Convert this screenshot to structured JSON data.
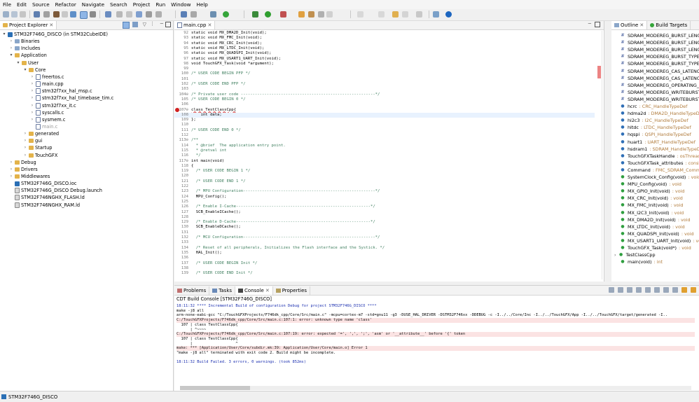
{
  "menu": [
    "File",
    "Edit",
    "Source",
    "Refactor",
    "Navigate",
    "Search",
    "Project",
    "Run",
    "Window",
    "Help"
  ],
  "project_explorer": {
    "tab_label": "Project Explorer",
    "tree": [
      {
        "label": "STM32F746G_DISCO (in STM32CubeIDE)",
        "depth": 0,
        "arrow": "▾",
        "kind": "ioc",
        "bold": true
      },
      {
        "label": "Binaries",
        "depth": 1,
        "arrow": "›",
        "kind": "pkg"
      },
      {
        "label": "Includes",
        "depth": 1,
        "arrow": "›",
        "kind": "pkg"
      },
      {
        "label": "Application",
        "depth": 1,
        "arrow": "▾",
        "kind": "folder"
      },
      {
        "label": "User",
        "depth": 2,
        "arrow": "▾",
        "kind": "folder"
      },
      {
        "label": "Core",
        "depth": 3,
        "arrow": "▾",
        "kind": "folder"
      },
      {
        "label": "freertos.c",
        "depth": 4,
        "arrow": "›",
        "kind": "cfile"
      },
      {
        "label": "main.cpp",
        "depth": 4,
        "arrow": "›",
        "kind": "cfile"
      },
      {
        "label": "stm32f7xx_hal_msp.c",
        "depth": 4,
        "arrow": "›",
        "kind": "cfile"
      },
      {
        "label": "stm32f7xx_hal_timebase_tim.c",
        "depth": 4,
        "arrow": "›",
        "kind": "cfile"
      },
      {
        "label": "stm32f7xx_it.c",
        "depth": 4,
        "arrow": "›",
        "kind": "cfile"
      },
      {
        "label": "syscalls.c",
        "depth": 4,
        "arrow": "›",
        "kind": "cfile"
      },
      {
        "label": "sysmem.c",
        "depth": 4,
        "arrow": "›",
        "kind": "cfile"
      },
      {
        "label": "main.c",
        "depth": 4,
        "arrow": "",
        "kind": "cfile",
        "dim": true
      },
      {
        "label": "generated",
        "depth": 3,
        "arrow": "›",
        "kind": "folder"
      },
      {
        "label": "gui",
        "depth": 3,
        "arrow": "›",
        "kind": "folder"
      },
      {
        "label": "Startup",
        "depth": 3,
        "arrow": "›",
        "kind": "folder"
      },
      {
        "label": "TouchGFX",
        "depth": 3,
        "arrow": "›",
        "kind": "folder"
      },
      {
        "label": "Debug",
        "depth": 1,
        "arrow": "›",
        "kind": "folder"
      },
      {
        "label": "Drivers",
        "depth": 1,
        "arrow": "›",
        "kind": "folder"
      },
      {
        "label": "Middlewares",
        "depth": 1,
        "arrow": "›",
        "kind": "folder"
      },
      {
        "label": "STM32F746G_DISCO.ioc",
        "depth": 1,
        "arrow": "",
        "kind": "ioc"
      },
      {
        "label": "STM32F746G_DISCO Debug.launch",
        "depth": 1,
        "arrow": "",
        "kind": "ld"
      },
      {
        "label": "STM32F746NGHX_FLASH.ld",
        "depth": 1,
        "arrow": "",
        "kind": "ld"
      },
      {
        "label": "STM32F746NGHX_RAM.ld",
        "depth": 1,
        "arrow": "",
        "kind": "ld"
      }
    ]
  },
  "editor": {
    "tab_label": "main.cpp",
    "lines": [
      {
        "n": "92",
        "t": "static void MX_DMA2D_Init(void);"
      },
      {
        "n": "93",
        "t": "static void MX_FMC_Init(void);"
      },
      {
        "n": "94",
        "t": "static void MX_CRC_Init(void);"
      },
      {
        "n": "95",
        "t": "static void MX_LTDC_Init(void);"
      },
      {
        "n": "96",
        "t": "static void MX_QUADSPI_Init(void);"
      },
      {
        "n": "97",
        "t": "static void MX_USART1_UART_Init(void);"
      },
      {
        "n": "98",
        "t": "void TouchGFX_Task(void *argument);"
      },
      {
        "n": "99",
        "t": ""
      },
      {
        "n": "100",
        "t": "/* USER CODE BEGIN PFP */",
        "c": true
      },
      {
        "n": "101",
        "t": ""
      },
      {
        "n": "102",
        "t": "/* USER CODE END PFP */",
        "c": true
      },
      {
        "n": "103",
        "t": ""
      },
      {
        "n": "104⊖",
        "t": "/* Private user code ---------------------------------------------------------*/",
        "c": true
      },
      {
        "n": "105",
        "t": "/* USER CODE BEGIN 0 */",
        "c": true
      },
      {
        "n": "106",
        "t": ""
      },
      {
        "n": "107⊖",
        "t": "class TestClassCpp{",
        "err": true
      },
      {
        "n": "108",
        "t": "    int data;",
        "hl": true
      },
      {
        "n": "109",
        "t": "};"
      },
      {
        "n": "110",
        "t": ""
      },
      {
        "n": "111",
        "t": "/* USER CODE END 0 */",
        "c": true
      },
      {
        "n": "112",
        "t": ""
      },
      {
        "n": "113⊖",
        "t": "/**",
        "c": true
      },
      {
        "n": "114",
        "t": "  * @brief  The application entry point.",
        "c": true
      },
      {
        "n": "115",
        "t": "  * @retval int",
        "c": true
      },
      {
        "n": "116",
        "t": "  */",
        "c": true
      },
      {
        "n": "117⊖",
        "t": "int main(void)"
      },
      {
        "n": "118",
        "t": "{"
      },
      {
        "n": "119",
        "t": "  /* USER CODE BEGIN 1 */",
        "c": true
      },
      {
        "n": "120",
        "t": ""
      },
      {
        "n": "121",
        "t": "  /* USER CODE END 1 */",
        "c": true
      },
      {
        "n": "122",
        "t": ""
      },
      {
        "n": "123",
        "t": "  /* MPU Configuration--------------------------------------------------------*/",
        "c": true
      },
      {
        "n": "124",
        "t": "  MPU_Config();"
      },
      {
        "n": "125",
        "t": ""
      },
      {
        "n": "126",
        "t": "  /* Enable I-Cache---------------------------------------------------------*/",
        "c": true
      },
      {
        "n": "127",
        "t": "  SCB_EnableICache();"
      },
      {
        "n": "128",
        "t": ""
      },
      {
        "n": "129",
        "t": "  /* Enable D-Cache---------------------------------------------------------*/",
        "c": true
      },
      {
        "n": "130",
        "t": "  SCB_EnableDCache();"
      },
      {
        "n": "131",
        "t": ""
      },
      {
        "n": "132",
        "t": "  /* MCU Configuration--------------------------------------------------------*/",
        "c": true
      },
      {
        "n": "133",
        "t": ""
      },
      {
        "n": "134",
        "t": "  /* Reset of all peripherals, Initializes the Flash interface and the Systick. */",
        "c": true
      },
      {
        "n": "135",
        "t": "  HAL_Init();"
      },
      {
        "n": "136",
        "t": ""
      },
      {
        "n": "137",
        "t": "  /* USER CODE BEGIN Init */",
        "c": true
      },
      {
        "n": "138",
        "t": ""
      },
      {
        "n": "139",
        "t": "  /* USER CODE END Init */",
        "c": true
      }
    ]
  },
  "outline": {
    "tabs": [
      "Outline",
      "Build Targets"
    ],
    "items": [
      {
        "name": "SDRAM_MODEREG_BURST_LENGTH",
        "type": "",
        "icon": "hash"
      },
      {
        "name": "SDRAM_MODEREG_BURST_LENGTH",
        "type": "",
        "icon": "hash"
      },
      {
        "name": "SDRAM_MODEREG_BURST_LENGTH",
        "type": "",
        "icon": "hash"
      },
      {
        "name": "SDRAM_MODEREG_BURST_TYPE_",
        "type": "",
        "icon": "hash"
      },
      {
        "name": "SDRAM_MODEREG_BURST_TYPE_",
        "type": "",
        "icon": "hash"
      },
      {
        "name": "SDRAM_MODEREG_CAS_LATENCY",
        "type": "",
        "icon": "hash"
      },
      {
        "name": "SDRAM_MODEREG_CAS_LATENCY",
        "type": "",
        "icon": "hash"
      },
      {
        "name": "SDRAM_MODEREG_OPERATING_M",
        "type": "",
        "icon": "hash"
      },
      {
        "name": "SDRAM_MODEREG_WRITEBURST",
        "type": "",
        "icon": "hash"
      },
      {
        "name": "SDRAM_MODEREG_WRITEBURST",
        "type": "",
        "icon": "hash"
      },
      {
        "name": "hcrc",
        "type": " : CRC_HandleTypeDef",
        "icon": "var"
      },
      {
        "name": "hdma2d",
        "type": " : DMA2D_HandleTypeDef",
        "icon": "var"
      },
      {
        "name": "hi2c3",
        "type": " : I2C_HandleTypeDef",
        "icon": "var"
      },
      {
        "name": "hltdc",
        "type": " : LTDC_HandleTypeDef",
        "icon": "var"
      },
      {
        "name": "hqspi",
        "type": " : QSPI_HandleTypeDef",
        "icon": "var"
      },
      {
        "name": "huart1",
        "type": " : UART_HandleTypeDef",
        "icon": "var"
      },
      {
        "name": "hsdram1",
        "type": " : SDRAM_HandleTypeDef",
        "icon": "var"
      },
      {
        "name": "TouchGFXTaskHandle",
        "type": " : osThreadId",
        "icon": "var"
      },
      {
        "name": "TouchGFXTask_attributes",
        "type": " : const osThreadAttr_t",
        "icon": "var"
      },
      {
        "name": "Command",
        "type": " : FMC_SDRAM_CommandTypeDef",
        "icon": "var"
      },
      {
        "name": "SystemClock_Config(void)",
        "type": " : void",
        "icon": "fn"
      },
      {
        "name": "MPU_Config(void)",
        "type": " : void",
        "icon": "sfn"
      },
      {
        "name": "MX_GPIO_Init(void)",
        "type": " : void",
        "icon": "sfn"
      },
      {
        "name": "MX_CRC_Init(void)",
        "type": " : void",
        "icon": "sfn"
      },
      {
        "name": "MX_FMC_Init(void)",
        "type": " : void",
        "icon": "sfn"
      },
      {
        "name": "MX_I2C3_Init(void)",
        "type": " : void",
        "icon": "sfn"
      },
      {
        "name": "MX_DMA2D_Init(void)",
        "type": " : void",
        "icon": "sfn"
      },
      {
        "name": "MX_LTDC_Init(void)",
        "type": " : void",
        "icon": "sfn"
      },
      {
        "name": "MX_QUADSPI_Init(void)",
        "type": " : void",
        "icon": "sfn"
      },
      {
        "name": "MX_USART1_UART_Init(void)",
        "type": " : void",
        "icon": "sfn"
      },
      {
        "name": "TouchGFX_Task(void*)",
        "type": " : void",
        "icon": "fn"
      },
      {
        "name": "TestClassCpp",
        "type": "",
        "icon": "class"
      },
      {
        "name": "main(void)",
        "type": " : int",
        "icon": "fn"
      }
    ]
  },
  "bottom": {
    "tabs": [
      "Problems",
      "Tasks",
      "Console",
      "Properties"
    ],
    "console_title": "CDT Build Console [STM32F746G_DISCO]",
    "lines": [
      {
        "t": "18:11:32 **** Incremental Build of configuration Debug for project STM32F746G_DISCO ****",
        "k": "blue"
      },
      {
        "t": "make -j8 all",
        "k": ""
      },
      {
        "t": "arm-none-eabi-gcc \"C:/TouchGFXProjects/F746dk_cpp/Core/Src/main.c\" -mcpu=cortex-m7 -std=gnu11 -g3 -DUSE_HAL_DRIVER -DSTM32F746xx -DDEBUG -c -I../../Core/Inc -I../../TouchGFX/App -I../../TouchGFX/target/generated -I..",
        "k": ""
      },
      {
        "t": "C:/TouchGFXProjects/F746dk_cpp/Core/Src/main.c:107:1: error: unknown type name 'class'",
        "k": "errbg"
      },
      {
        "t": "  107 | class TestClassCpp{",
        "k": ""
      },
      {
        "t": "      | ^~~~~",
        "k": ""
      },
      {
        "t": "C:/TouchGFXProjects/F746dk_cpp/Core/Src/main.c:107:19: error: expected '=', ',', ';', 'asm' or '__attribute__' before '{' token",
        "k": "errbg"
      },
      {
        "t": "  107 | class TestClassCpp{",
        "k": ""
      },
      {
        "t": "      |                   ^",
        "k": ""
      },
      {
        "t": "make: *** [Application/User/Core/subdir.mk:39: Application/User/Core/main.o] Error 1",
        "k": "errbg"
      },
      {
        "t": "\"make -j8 all\" terminated with exit code 2. Build might be incomplete.",
        "k": ""
      },
      {
        "t": "",
        "k": ""
      },
      {
        "t": "18:11:32 Build Failed. 3 errors, 0 warnings. (took 852ms)",
        "k": "blue"
      }
    ]
  },
  "status": {
    "label": "STM32F746G_DISCO"
  }
}
